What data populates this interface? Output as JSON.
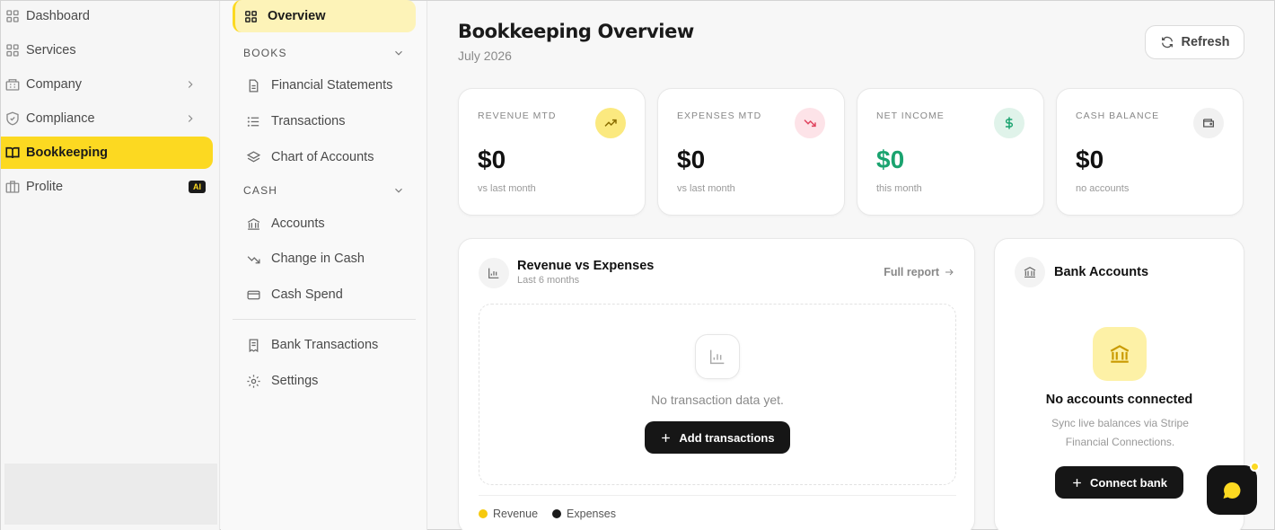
{
  "sidebar": {
    "items": [
      {
        "label": "Dashboard",
        "icon": "grid-icon"
      },
      {
        "label": "Services",
        "icon": "apps-icon"
      },
      {
        "label": "Company",
        "icon": "building-icon"
      },
      {
        "label": "Compliance",
        "icon": "shield-icon"
      },
      {
        "label": "Bookkeeping",
        "icon": "book-icon",
        "active": true
      },
      {
        "label": "Prolite",
        "icon": "briefcase-icon",
        "badge": "AI"
      }
    ]
  },
  "subnav": {
    "overview": "Overview",
    "books_heading": "BOOKS",
    "financial_statements": "Financial Statements",
    "transactions": "Transactions",
    "chart_of_accounts": "Chart of Accounts",
    "cash_heading": "CASH",
    "accounts": "Accounts",
    "change_in_cash": "Change in Cash",
    "cash_spend": "Cash Spend",
    "bank_transactions": "Bank Transactions",
    "settings": "Settings"
  },
  "header": {
    "title": "Bookkeeping Overview",
    "period": "July 2026",
    "refresh_label": "Refresh"
  },
  "stats": [
    {
      "label": "REVENUE MTD",
      "value": "$0",
      "hint": "vs last month",
      "icon": "trending-up-icon",
      "accent": "#fbe97f"
    },
    {
      "label": "EXPENSES MTD",
      "value": "$0",
      "hint": "vs last month",
      "icon": "trending-down-icon",
      "accent": "#fde3e8"
    },
    {
      "label": "NET INCOME",
      "value": "$0",
      "hint": "this month",
      "icon": "dollar-icon",
      "accent": "#e0f3ea"
    },
    {
      "label": "CASH BALANCE",
      "value": "$0",
      "hint": "no accounts",
      "icon": "wallet-icon",
      "accent": "#f1f1f1"
    }
  ],
  "chart_card": {
    "title": "Revenue vs Expenses",
    "subtitle": "Last 6 months",
    "full_report": "Full report",
    "empty_text": "No transaction data yet.",
    "add_button": "Add transactions",
    "legend": [
      {
        "name": "Revenue",
        "color": "#f6c90e"
      },
      {
        "name": "Expenses",
        "color": "#1a1a1a"
      }
    ]
  },
  "bank_card": {
    "title": "Bank Accounts",
    "empty_title": "No accounts connected",
    "empty_sub": "Sync live balances via Stripe Financial Connections.",
    "connect_button": "Connect bank"
  },
  "colors": {
    "brand": "#fcd921",
    "positive": "#1aa36f",
    "negative": "#e0445f"
  }
}
